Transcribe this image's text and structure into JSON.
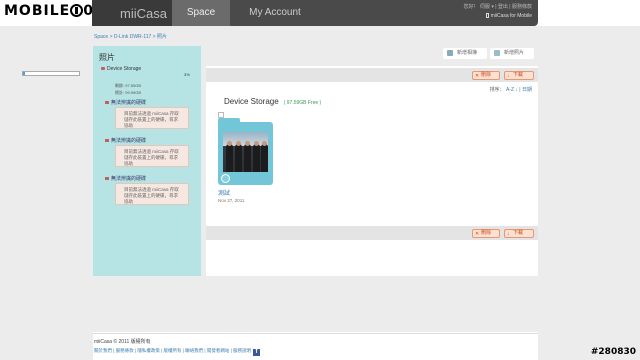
{
  "watermark": "MOBILE01",
  "header": {
    "logo": "miiCasa",
    "tabs": [
      "Space",
      "My Account"
    ],
    "top_links": "您好！ 伺服 ▾ | 登出 | 服務條款",
    "mobile_link": "miiCasa for Mobile"
  },
  "breadcrumb": "Space > D-Link DWR-117 > 照片",
  "sidebar": {
    "title": "照片",
    "storage_name": "Device Storage",
    "percent": "3%",
    "usage_fraction": 0.03,
    "remaining": "剩餘: 97.59GB",
    "total": "總計: 99.99GB",
    "warnings": [
      {
        "title": "無法辨識的硬碟",
        "text": "目前無法透過 miiCasa 存取儲存此裝置上的硬碟，尋求協助"
      },
      {
        "title": "無法辨識的硬碟",
        "text": "目前無法透過 miiCasa 存取儲存此裝置上的硬碟，尋求協助"
      },
      {
        "title": "無法辨識的硬碟",
        "text": "目前無法透過 miiCasa 存取儲存此裝置上的硬碟，尋求協助"
      }
    ]
  },
  "toolbar": {
    "new_album": "新增相簿",
    "new_photo": "新增照片"
  },
  "actions": {
    "delete": "刪除",
    "download": "下載"
  },
  "main": {
    "sort_label": "排序：",
    "sort_az": "A-Z ↓",
    "sort_date": "日期",
    "device_title": "Device Storage",
    "free_space": "( 97.59GB Free )",
    "item_name": "測試",
    "item_date": "Nov 27, 2011"
  },
  "footer": {
    "copyright": "miiCasa © 2011  版權所有",
    "links": "關於我們 | 服務條款 | 隱私權政策 | 版權所有 | 聯絡我們 | 開發者網站 | 服務說明",
    "fb": "f"
  },
  "watermark2": "#280830"
}
